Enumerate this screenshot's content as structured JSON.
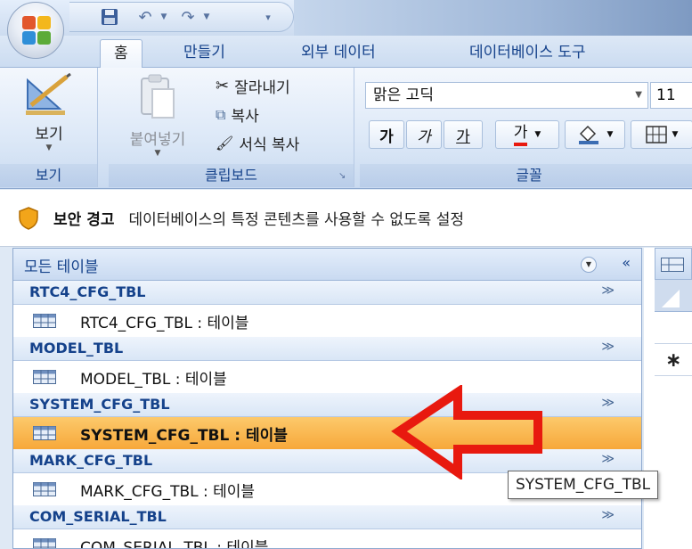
{
  "colors": {
    "accent": "#15428b",
    "selected_row": "#f7a83a",
    "annotation_arrow": "#e8190f"
  },
  "ribbon": {
    "tabs": [
      "홈",
      "만들기",
      "외부 데이터",
      "데이터베이스 도구"
    ],
    "groups": {
      "view": {
        "button_label": "보기",
        "label": "보기"
      },
      "clipboard": {
        "paste_label": "붙여넣기",
        "cut_label": "잘라내기",
        "copy_label": "복사",
        "format_painter_label": "서식 복사",
        "label": "클립보드"
      },
      "font": {
        "font_name": "맑은 고딕",
        "font_size": "11",
        "bold_glyph": "가",
        "italic_glyph": "가",
        "underline_glyph": "가",
        "font_color_glyph": "가",
        "label": "글꼴"
      }
    }
  },
  "security_bar": {
    "title": "보안 경고",
    "message": "데이터베이스의 특정 콘텐츠를 사용할 수 없도록 설정"
  },
  "nav_pane": {
    "title": "모든 테이블",
    "collapse_glyph": "«",
    "sections": [
      {
        "title": "RTC4_CFG_TBL",
        "item": "RTC4_CFG_TBL : 테이블",
        "selected": false
      },
      {
        "title": "MODEL_TBL",
        "item": "MODEL_TBL : 테이블",
        "selected": false
      },
      {
        "title": "SYSTEM_CFG_TBL",
        "item": "SYSTEM_CFG_TBL : 테이블",
        "selected": true
      },
      {
        "title": "MARK_CFG_TBL",
        "item": "MARK_CFG_TBL : 테이블",
        "selected": false
      },
      {
        "title": "COM_SERIAL_TBL",
        "item": "COM_SERIAL_TBL : 테이블",
        "selected": false
      }
    ]
  },
  "datasheet": {
    "new_row_marker": "∗"
  },
  "tooltip": {
    "text": "SYSTEM_CFG_TBL"
  }
}
